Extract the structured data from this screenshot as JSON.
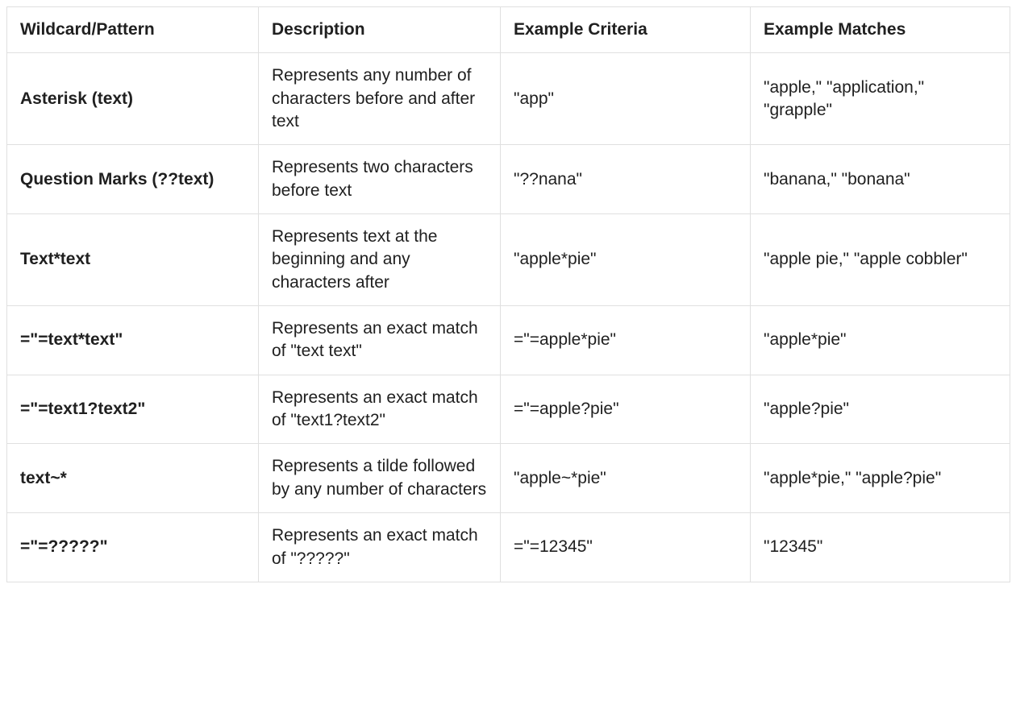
{
  "table": {
    "headers": {
      "pattern": "Wildcard/Pattern",
      "description": "Description",
      "criteria": "Example Criteria",
      "matches": "Example Matches"
    },
    "rows": [
      {
        "pattern": "Asterisk (text)",
        "description": "Represents any number of characters before and after text",
        "criteria": "\"app\"",
        "matches": "\"apple,\" \"application,\" \"grapple\""
      },
      {
        "pattern": "Question Marks (??text)",
        "description": "Represents two characters before text",
        "criteria": "\"??nana\"",
        "matches": "\"banana,\" \"bonana\""
      },
      {
        "pattern": "Text*text",
        "description": "Represents text at the beginning and any characters after",
        "criteria": "\"apple*pie\"",
        "matches": "\"apple pie,\" \"apple cobbler\""
      },
      {
        "pattern": "=\"=text*text\"",
        "description": "Represents an exact match of \"text text\"",
        "criteria": "=\"=apple*pie\"",
        "matches": "\"apple*pie\""
      },
      {
        "pattern": "=\"=text1?text2\"",
        "description": "Represents an exact match of \"text1?text2\"",
        "criteria": "=\"=apple?pie\"",
        "matches": "\"apple?pie\""
      },
      {
        "pattern": "text~*",
        "description": "Represents a tilde followed by any number of characters",
        "criteria": "\"apple~*pie\"",
        "matches": "\"apple*pie,\" \"apple?pie\""
      },
      {
        "pattern": "=\"=?????\"",
        "description": "Represents an exact match of \"?????\"",
        "criteria": "=\"=12345\"",
        "matches": "\"12345\""
      }
    ]
  }
}
